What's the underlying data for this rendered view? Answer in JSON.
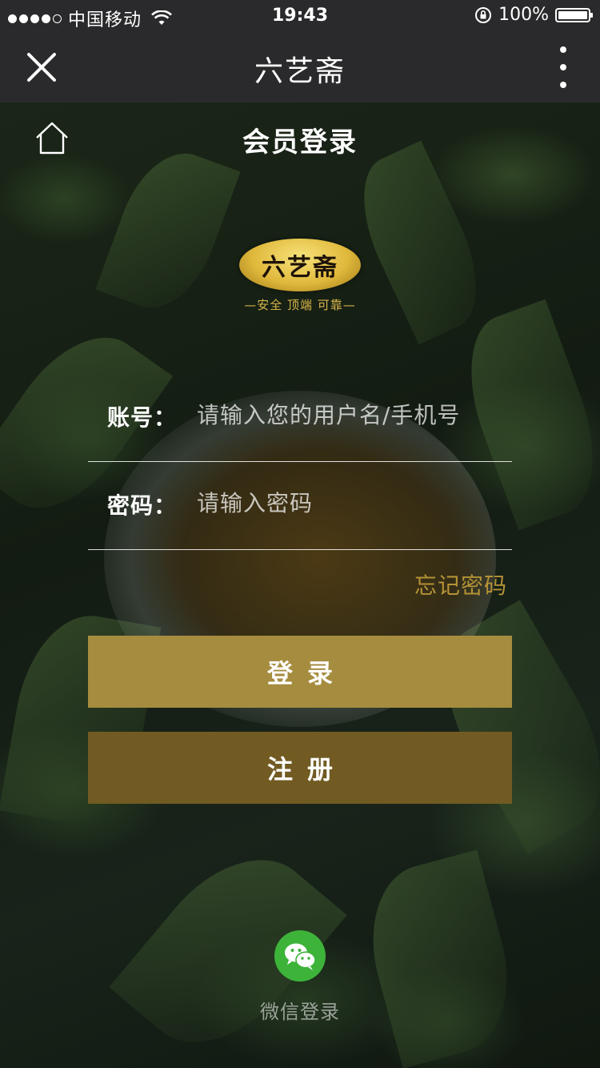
{
  "status_bar": {
    "carrier": "中国移动",
    "time": "19:43",
    "battery": "100%"
  },
  "nav": {
    "title": "六艺斋"
  },
  "page": {
    "title": "会员登录"
  },
  "logo": {
    "name": "六艺斋",
    "slogan": "—安全 顶端 可靠—"
  },
  "form": {
    "account_label": "账号：",
    "account_placeholder": "请输入您的用户名/手机号",
    "password_label": "密码：",
    "password_placeholder": "请输入密码",
    "forgot_label": "忘记密码",
    "login_label": "登录",
    "register_label": "注册"
  },
  "wechat": {
    "label": "微信登录"
  },
  "colors": {
    "bar_bg": "#2a2a2c",
    "login_button": "#a68c3f",
    "register_button": "#715b22",
    "forgot_link": "#b49236",
    "wechat_green": "#3db33a"
  }
}
